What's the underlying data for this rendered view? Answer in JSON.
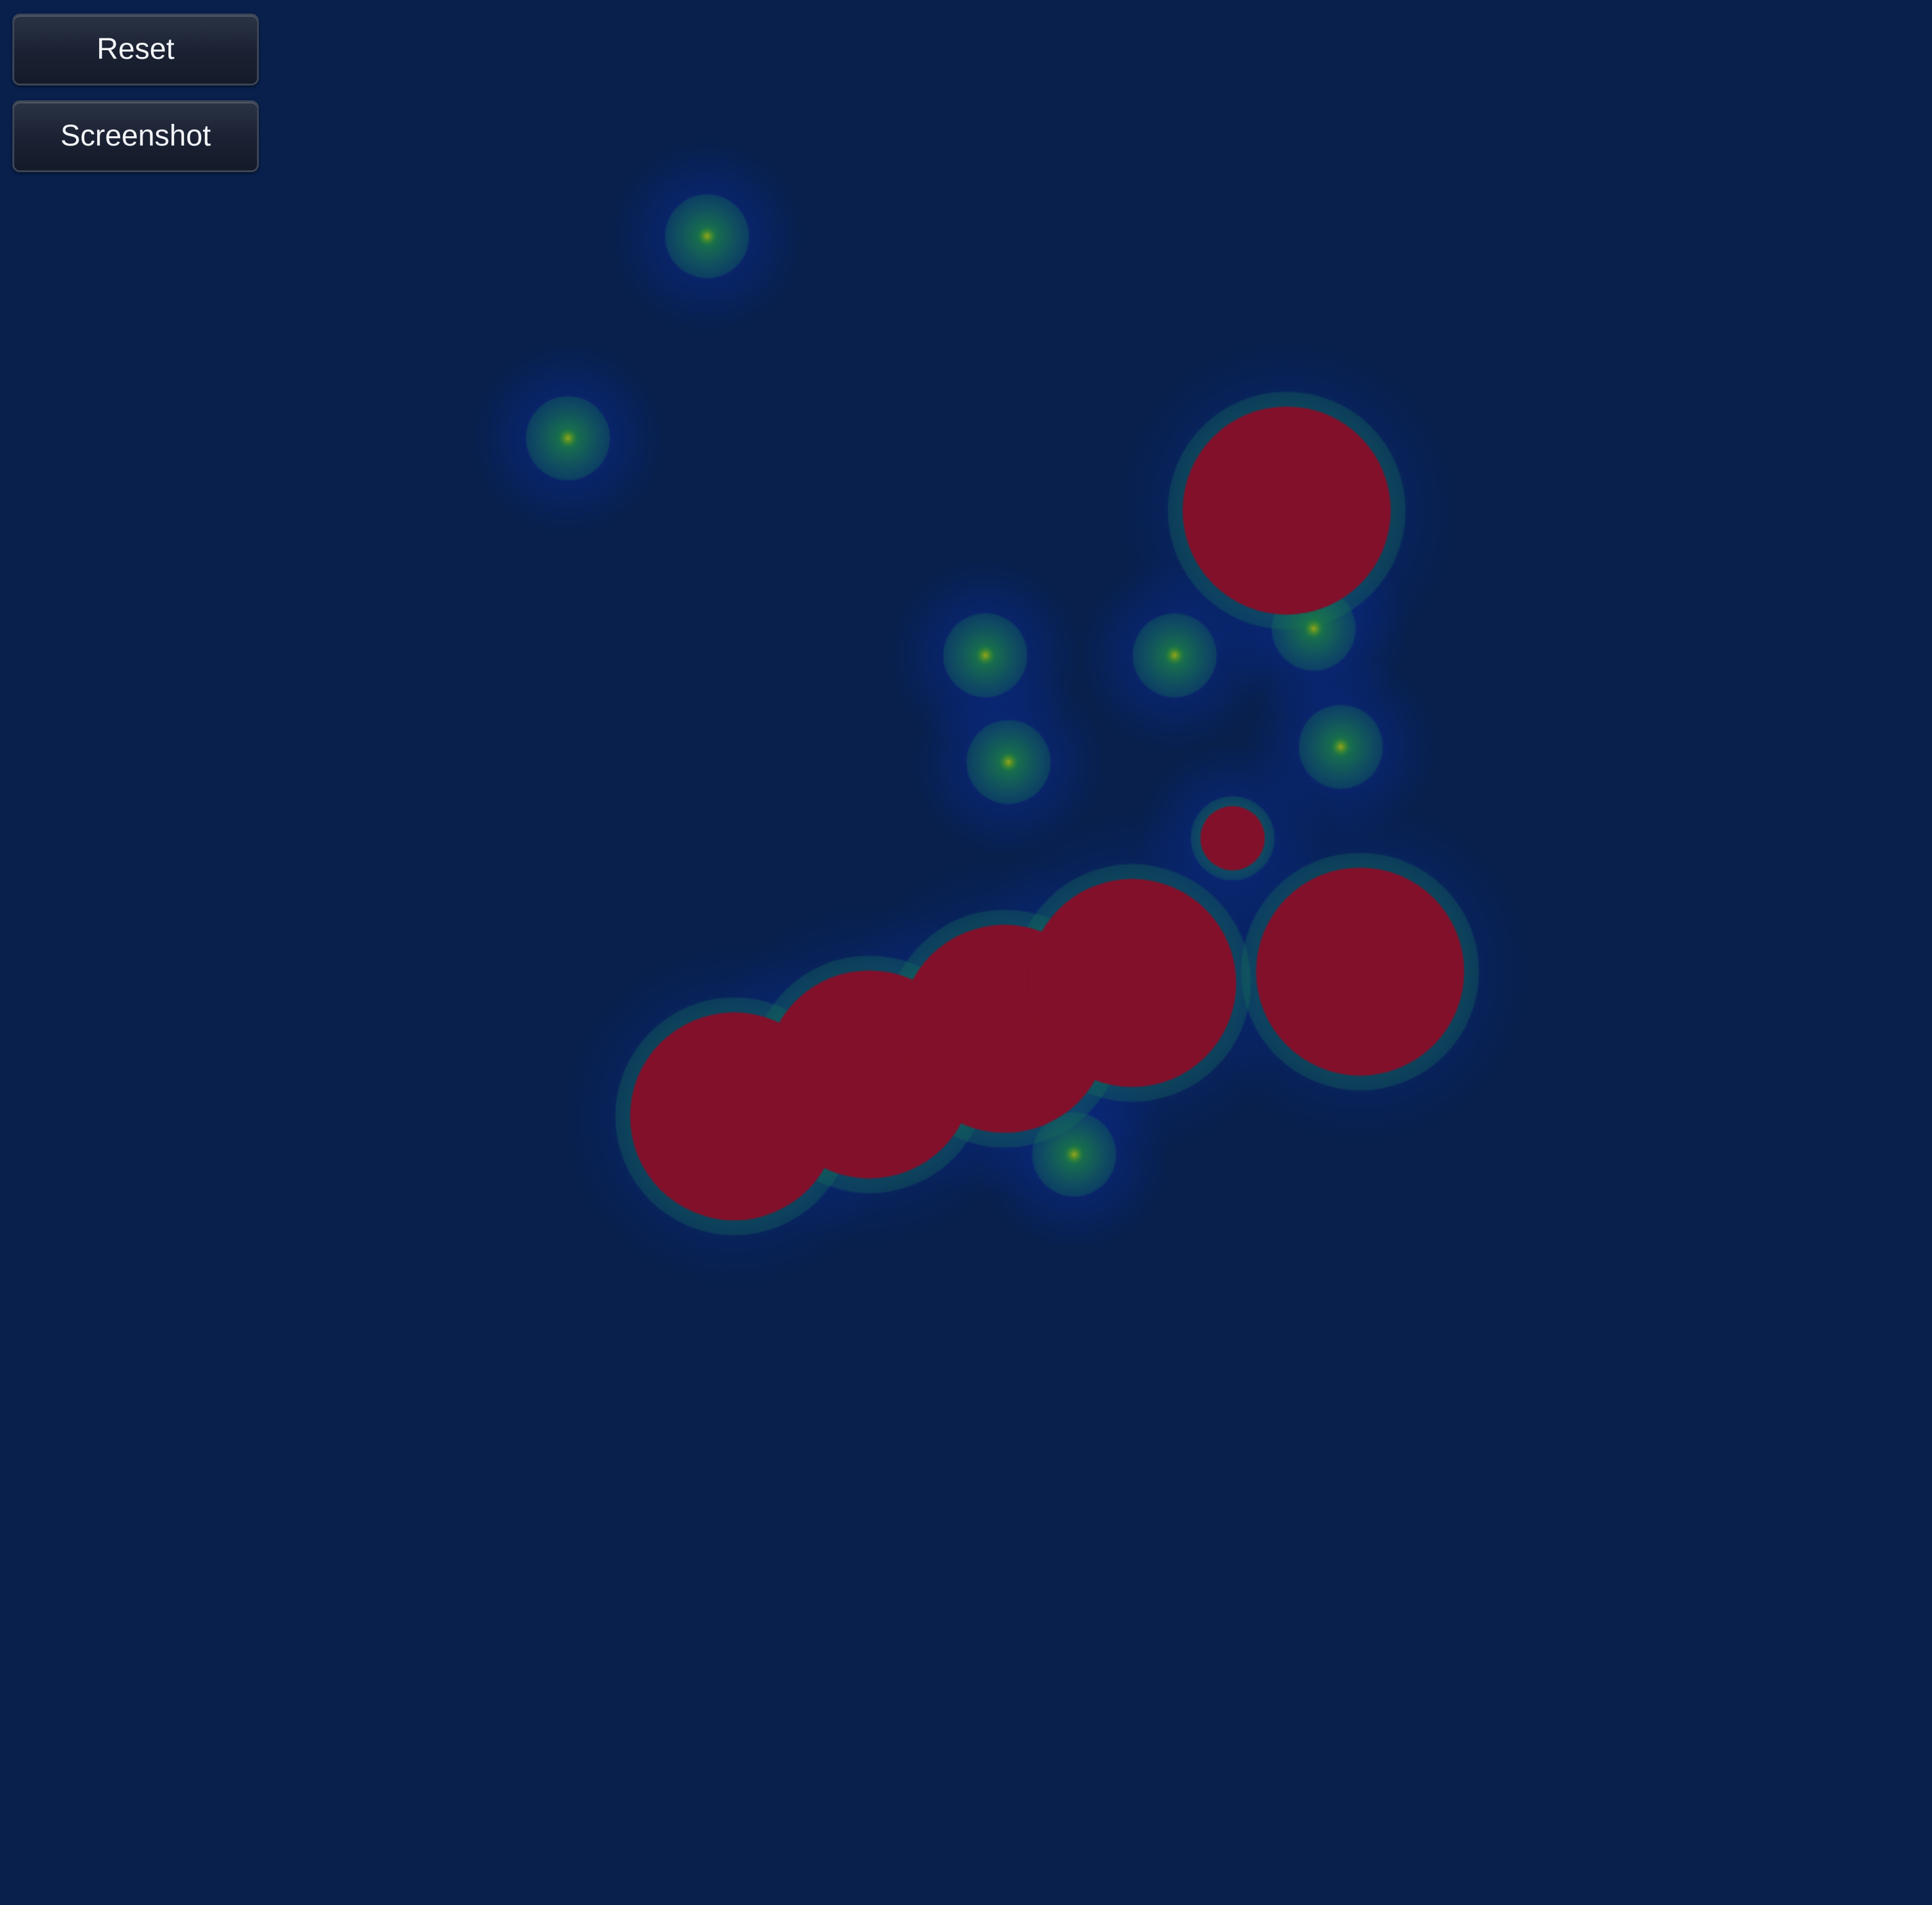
{
  "toolbar": {
    "reset_label": "Reset",
    "screenshot_label": "Screenshot"
  },
  "colors": {
    "background": "#08204b",
    "cold": "#0a2a8a",
    "mid": "#1a7a55",
    "warm": "#2a8a2a",
    "hot": "#82102a"
  },
  "heatmap": {
    "coordinate_space": "normalized canvas fraction",
    "points": [
      {
        "x": 0.183,
        "y": 0.062,
        "intensity": 0.35
      },
      {
        "x": 0.147,
        "y": 0.115,
        "intensity": 0.35
      },
      {
        "x": 0.333,
        "y": 0.134,
        "intensity": 1.0
      },
      {
        "x": 0.304,
        "y": 0.172,
        "intensity": 0.35
      },
      {
        "x": 0.34,
        "y": 0.165,
        "intensity": 0.35
      },
      {
        "x": 0.347,
        "y": 0.196,
        "intensity": 0.35
      },
      {
        "x": 0.255,
        "y": 0.172,
        "intensity": 0.35
      },
      {
        "x": 0.261,
        "y": 0.2,
        "intensity": 0.35
      },
      {
        "x": 0.319,
        "y": 0.22,
        "intensity": 0.6
      },
      {
        "x": 0.352,
        "y": 0.255,
        "intensity": 1.0
      },
      {
        "x": 0.19,
        "y": 0.293,
        "intensity": 1.0
      },
      {
        "x": 0.225,
        "y": 0.282,
        "intensity": 1.0
      },
      {
        "x": 0.26,
        "y": 0.27,
        "intensity": 1.0
      },
      {
        "x": 0.293,
        "y": 0.258,
        "intensity": 1.0
      },
      {
        "x": 0.278,
        "y": 0.303,
        "intensity": 0.35
      }
    ]
  }
}
